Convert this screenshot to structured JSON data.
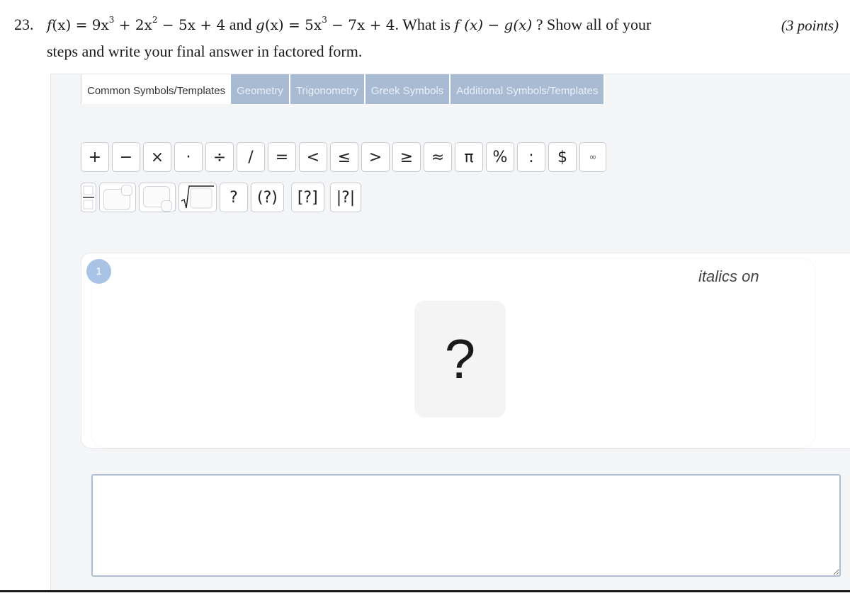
{
  "question": {
    "number": "23.",
    "f_label": "f",
    "f_arg": "(x) = 9x",
    "f_p1": "3",
    "f_mid": " + 2x",
    "f_p2": "2",
    "f_rest": " − 5x + 4",
    "and_word": " and ",
    "g_label": "g",
    "g_arg": "(x) = 5x",
    "g_p1": "3",
    "g_rest": " − 7x + 4",
    "ask_prefix": ". What is ",
    "diff": "f (x) − g(x)",
    "ask_suffix": " ? Show all of your",
    "line2": "steps and write your final answer in factored form.",
    "points": "(3 points)"
  },
  "tabs": [
    {
      "label": "Common Symbols/Templates",
      "active": true
    },
    {
      "label": "Geometry"
    },
    {
      "label": "Trigonometry"
    },
    {
      "label": "Greek Symbols"
    },
    {
      "label": "Additional Symbols/Templates"
    }
  ],
  "palette": {
    "row1": [
      "+",
      "−",
      "×",
      "·",
      "÷",
      "/",
      "=",
      "<",
      "≤",
      ">",
      "≥",
      "≈",
      "π",
      "%",
      ":",
      "$",
      "∞"
    ],
    "row2_text": [
      "?",
      "(?)",
      "[?]",
      "|?|"
    ]
  },
  "answer": {
    "step_number": "1",
    "italics_status": "italics on",
    "placeholder": "?"
  },
  "response_box": {
    "value": ""
  }
}
